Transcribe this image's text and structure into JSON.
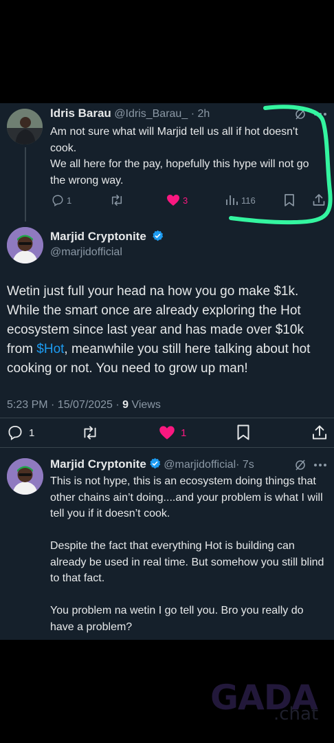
{
  "colors": {
    "background": "#15202b",
    "text": "#e7e9ea",
    "muted": "#8b98a5",
    "link": "#1d9bf0",
    "like": "#f91880",
    "verified": "#1d9bf0",
    "highlight": "#34f5a0"
  },
  "reply1": {
    "name": "Idris Barau",
    "handle": "@Idris_Barau_",
    "time": "· 2h",
    "text": "Am not sure what will Marjid tell us all if hot doesn't cook.\nWe all here for the pay, hopefully this hype will not go the wrong way.",
    "replies": "1",
    "likes": "3",
    "views": "116"
  },
  "main": {
    "name": "Marjid Cryptonite",
    "handle": "@marjidofficial",
    "text_before": "Wetin just full your head na how you go make $1k. While the smart once are already exploring the Hot ecosystem since last year and has made over $10k from ",
    "cashtag": "$Hot",
    "text_after": ", meanwhile you still here talking about hot cooking or not. You need to grow up man!",
    "timestamp": "5:23 PM · 15/07/2025 · ",
    "views_count": "9",
    "views_label": " Views",
    "replies": "1",
    "likes": "1"
  },
  "reply2": {
    "name": "Marjid Cryptonite",
    "handle": "@marjidofficial",
    "time": "· 7s",
    "text": "This is not hype, this is an ecosystem doing things that other chains ain’t doing....and your problem is what I will tell you if it doesn’t cook.\n\nDespite the fact that everything Hot is building can already be used in real time. But somehow you still blind to that fact.\n\nYou problem na wetin I go tell you. Bro you really do have a problem?"
  },
  "watermark": {
    "brand": "GADA",
    "suffix": ".chat"
  }
}
